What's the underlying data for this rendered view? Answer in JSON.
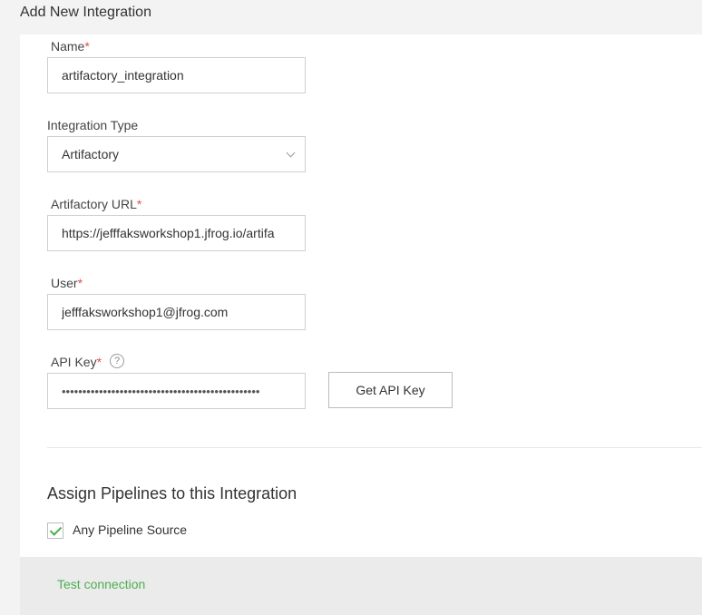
{
  "page": {
    "title": "Add New Integration"
  },
  "form": {
    "name": {
      "label": "Name",
      "required_mark": "*",
      "value": "artifactory_integration"
    },
    "integration_type": {
      "label": "Integration Type",
      "value": "Artifactory"
    },
    "url": {
      "label": "Artifactory URL",
      "required_mark": "*",
      "value": "https://jefffaksworkshop1.jfrog.io/artifa"
    },
    "user": {
      "label": "User",
      "required_mark": "*",
      "value": "jefffaksworkshop1@jfrog.com"
    },
    "api_key": {
      "label": "API Key",
      "required_mark": "*",
      "help_icon": "?",
      "value": "••••••••••••••••••••••••••••••••••••••••••••••••",
      "button_label": "Get API Key"
    }
  },
  "assign": {
    "title": "Assign Pipelines to this Integration",
    "any_source_label": "Any Pipeline Source",
    "any_source_checked": true
  },
  "footer": {
    "test_connection_label": "Test connection"
  },
  "colors": {
    "accent_green": "#4caf50",
    "required_red": "#e44d4d"
  },
  "icons": {
    "select": "chevron-down-icon",
    "help": "question-circle-icon",
    "checkbox": "checkmark-icon"
  }
}
